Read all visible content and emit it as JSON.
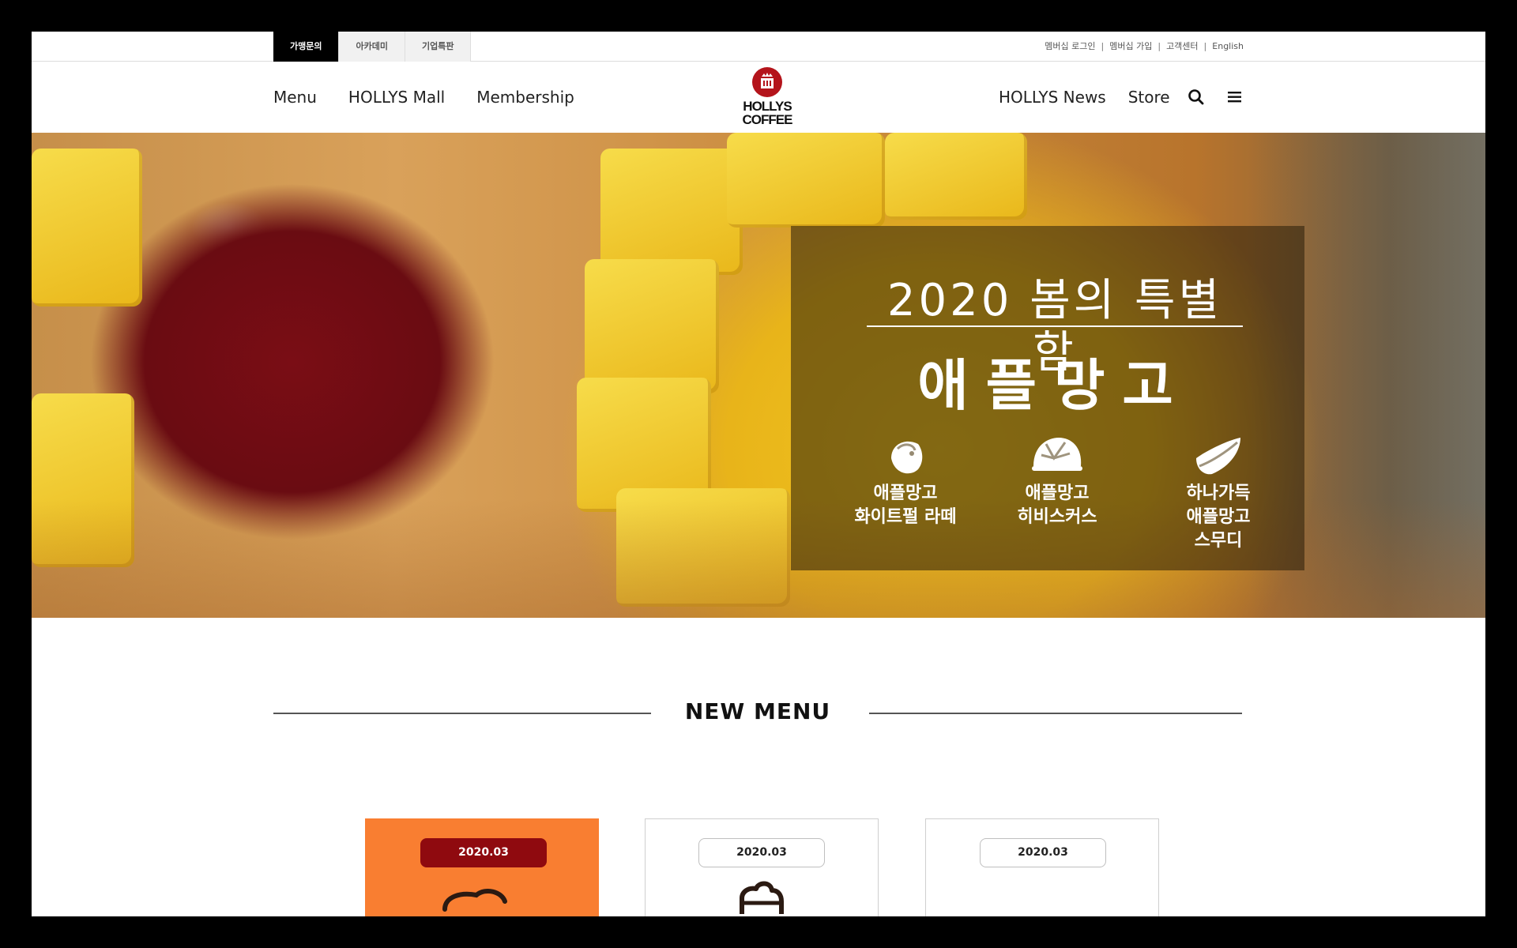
{
  "utility": {
    "tabs": [
      "가맹문의",
      "아카데미",
      "기업특판"
    ],
    "links": [
      "멤버십 로그인",
      "멤버십 가입",
      "고객센터",
      "English"
    ],
    "separator": "|"
  },
  "header": {
    "nav_left": [
      "Menu",
      "HOLLYS Mall",
      "Membership"
    ],
    "nav_right": [
      "HOLLYS News",
      "Store"
    ],
    "logo": {
      "line1": "HOLLYS",
      "line2": "COFFEE",
      "color": "#b4141b"
    },
    "icons": [
      "search-icon",
      "hamburger-menu-icon"
    ]
  },
  "hero": {
    "subtitle": "2020 봄의 특별함",
    "title": "애플망고",
    "items": [
      {
        "label": "애플망고\n화이트펄 라떼",
        "icon": "pearl-latte-icon"
      },
      {
        "label": "애플망고\n히비스커스",
        "icon": "hibiscus-icon"
      },
      {
        "label": "하나가득\n애플망고\n스무디",
        "icon": "mango-slice-icon"
      }
    ]
  },
  "new_menu": {
    "title": "NEW MENU",
    "cards": [
      {
        "date": "2020.03",
        "featured": true,
        "bg": "#f97e31",
        "badge_color": "#8f0a0f"
      },
      {
        "date": "2020.03",
        "featured": false
      },
      {
        "date": "2020.03",
        "featured": false
      }
    ]
  }
}
